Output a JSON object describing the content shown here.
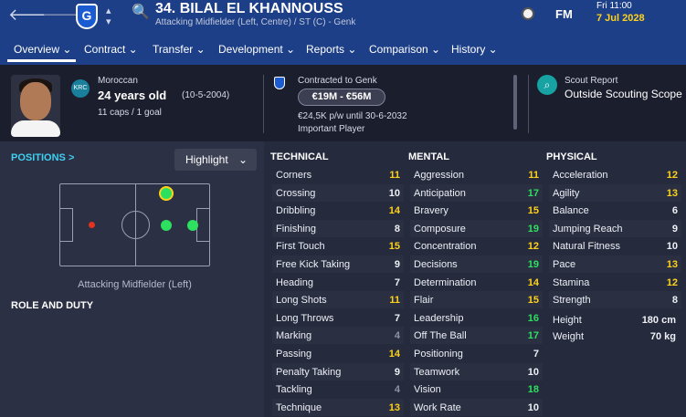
{
  "header": {
    "player_name": "34. BILAL EL KHANNOUSS",
    "player_sub": "Attacking Midfielder (Left, Centre) / ST (C) - Genk",
    "club_initial": "G",
    "time": "Fri 11:00",
    "date": "7 Jul 2028",
    "brand": "FM"
  },
  "nav": {
    "tabs": [
      {
        "label": "Overview ⌄"
      },
      {
        "label": "Contract ⌄"
      },
      {
        "label": "Transfer ⌄"
      },
      {
        "label": "Development ⌄"
      },
      {
        "label": "Reports ⌄"
      },
      {
        "label": "Comparison ⌄"
      },
      {
        "label": "History ⌄"
      }
    ]
  },
  "info": {
    "nationality": "Moroccan",
    "age": "24 years old",
    "birth": "(10-5-2004)",
    "caps": "11 caps / 1 goal",
    "club_code": "KRC",
    "contract_label": "Contracted to Genk",
    "value": "€19M - €56M",
    "wage": "€24,5K p/w until 30-6-2032",
    "status": "Important Player",
    "scout_title": "Scout Report",
    "scout_sub": "Outside Scouting Scope"
  },
  "positions": {
    "label": "POSITIONS >",
    "highlight": "Highlight",
    "caption": "Attacking Midfielder (Left)",
    "role_title": "ROLE AND DUTY"
  },
  "colors": {
    "high": "#2de05f",
    "mid": "#ffd21a",
    "low": "#8e93a3",
    "white": "#eef0f6"
  },
  "technical": {
    "title": "TECHNICAL",
    "items": [
      {
        "name": "Corners",
        "value": "11",
        "tone": "mid"
      },
      {
        "name": "Crossing",
        "value": "10",
        "tone": "white"
      },
      {
        "name": "Dribbling",
        "value": "14",
        "tone": "mid"
      },
      {
        "name": "Finishing",
        "value": "8",
        "tone": "white"
      },
      {
        "name": "First Touch",
        "value": "15",
        "tone": "mid"
      },
      {
        "name": "Free Kick Taking",
        "value": "9",
        "tone": "white"
      },
      {
        "name": "Heading",
        "value": "7",
        "tone": "white"
      },
      {
        "name": "Long Shots",
        "value": "11",
        "tone": "mid"
      },
      {
        "name": "Long Throws",
        "value": "7",
        "tone": "white"
      },
      {
        "name": "Marking",
        "value": "4",
        "tone": "low"
      },
      {
        "name": "Passing",
        "value": "14",
        "tone": "mid"
      },
      {
        "name": "Penalty Taking",
        "value": "9",
        "tone": "white"
      },
      {
        "name": "Tackling",
        "value": "4",
        "tone": "low"
      },
      {
        "name": "Technique",
        "value": "13",
        "tone": "mid"
      }
    ]
  },
  "mental": {
    "title": "MENTAL",
    "items": [
      {
        "name": "Aggression",
        "value": "11",
        "tone": "mid"
      },
      {
        "name": "Anticipation",
        "value": "17",
        "tone": "high"
      },
      {
        "name": "Bravery",
        "value": "15",
        "tone": "mid"
      },
      {
        "name": "Composure",
        "value": "19",
        "tone": "high"
      },
      {
        "name": "Concentration",
        "value": "12",
        "tone": "mid"
      },
      {
        "name": "Decisions",
        "value": "19",
        "tone": "high"
      },
      {
        "name": "Determination",
        "value": "14",
        "tone": "mid"
      },
      {
        "name": "Flair",
        "value": "15",
        "tone": "mid"
      },
      {
        "name": "Leadership",
        "value": "16",
        "tone": "high"
      },
      {
        "name": "Off The Ball",
        "value": "17",
        "tone": "high"
      },
      {
        "name": "Positioning",
        "value": "7",
        "tone": "white"
      },
      {
        "name": "Teamwork",
        "value": "10",
        "tone": "white"
      },
      {
        "name": "Vision",
        "value": "18",
        "tone": "high"
      },
      {
        "name": "Work Rate",
        "value": "10",
        "tone": "white"
      }
    ]
  },
  "physical": {
    "title": "PHYSICAL",
    "items": [
      {
        "name": "Acceleration",
        "value": "12",
        "tone": "mid"
      },
      {
        "name": "Agility",
        "value": "13",
        "tone": "mid"
      },
      {
        "name": "Balance",
        "value": "6",
        "tone": "white"
      },
      {
        "name": "Jumping Reach",
        "value": "9",
        "tone": "white"
      },
      {
        "name": "Natural Fitness",
        "value": "10",
        "tone": "white"
      },
      {
        "name": "Pace",
        "value": "13",
        "tone": "mid"
      },
      {
        "name": "Stamina",
        "value": "12",
        "tone": "mid"
      },
      {
        "name": "Strength",
        "value": "8",
        "tone": "white"
      }
    ],
    "height_label": "Height",
    "height": "180 cm",
    "weight_label": "Weight",
    "weight": "70 kg"
  }
}
